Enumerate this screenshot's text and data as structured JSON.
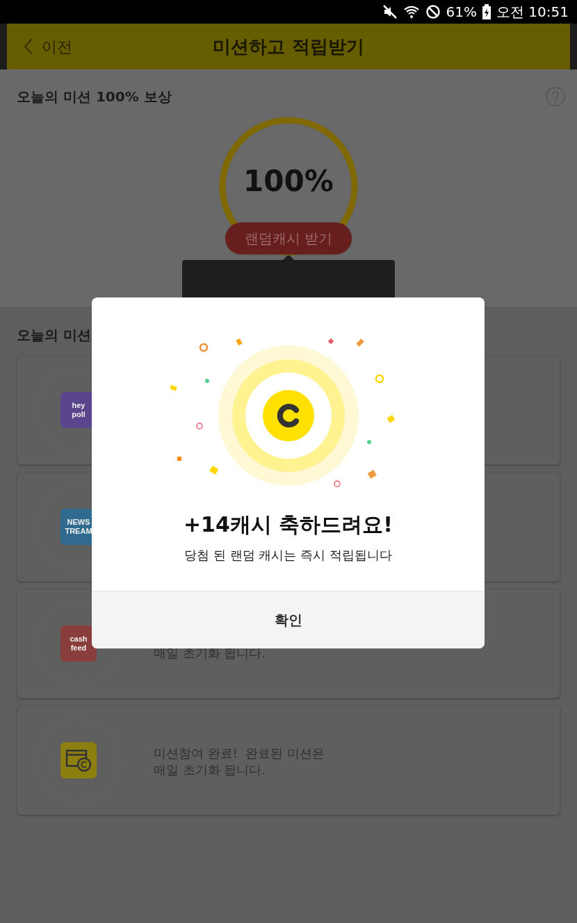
{
  "status_bar": {
    "battery": "61%",
    "time": "오전 10:51"
  },
  "header": {
    "back": "이전",
    "title": "미션하고 적립받기"
  },
  "reward": {
    "title": "오늘의 미션 100% 보상",
    "progress": "100%",
    "button": "랜덤캐시 받기"
  },
  "missions": {
    "title": "오늘의 미션",
    "items": [
      {
        "kind": "logo",
        "logo": [
          "hey",
          "poll"
        ],
        "color": "#5a468c"
      },
      {
        "kind": "logo",
        "logo": [
          "NEWS",
          "TREAM"
        ],
        "color": "#306a8e"
      },
      {
        "kind": "logo",
        "logo": [
          "cash",
          "feed"
        ],
        "color": "#8a3e3b",
        "lines": [
          "매일 초기화 됩니다."
        ]
      },
      {
        "kind": "icon",
        "color": "#8c7f10",
        "lines": [
          "미션참여 완료!  완료된 미션은",
          "매일 초기화 됩니다."
        ]
      }
    ]
  },
  "dialog": {
    "title": "+14캐시 축하드려요!",
    "message": "당첨 된 랜덤 캐시는 즉시 적립됩니다",
    "button": "확인"
  }
}
